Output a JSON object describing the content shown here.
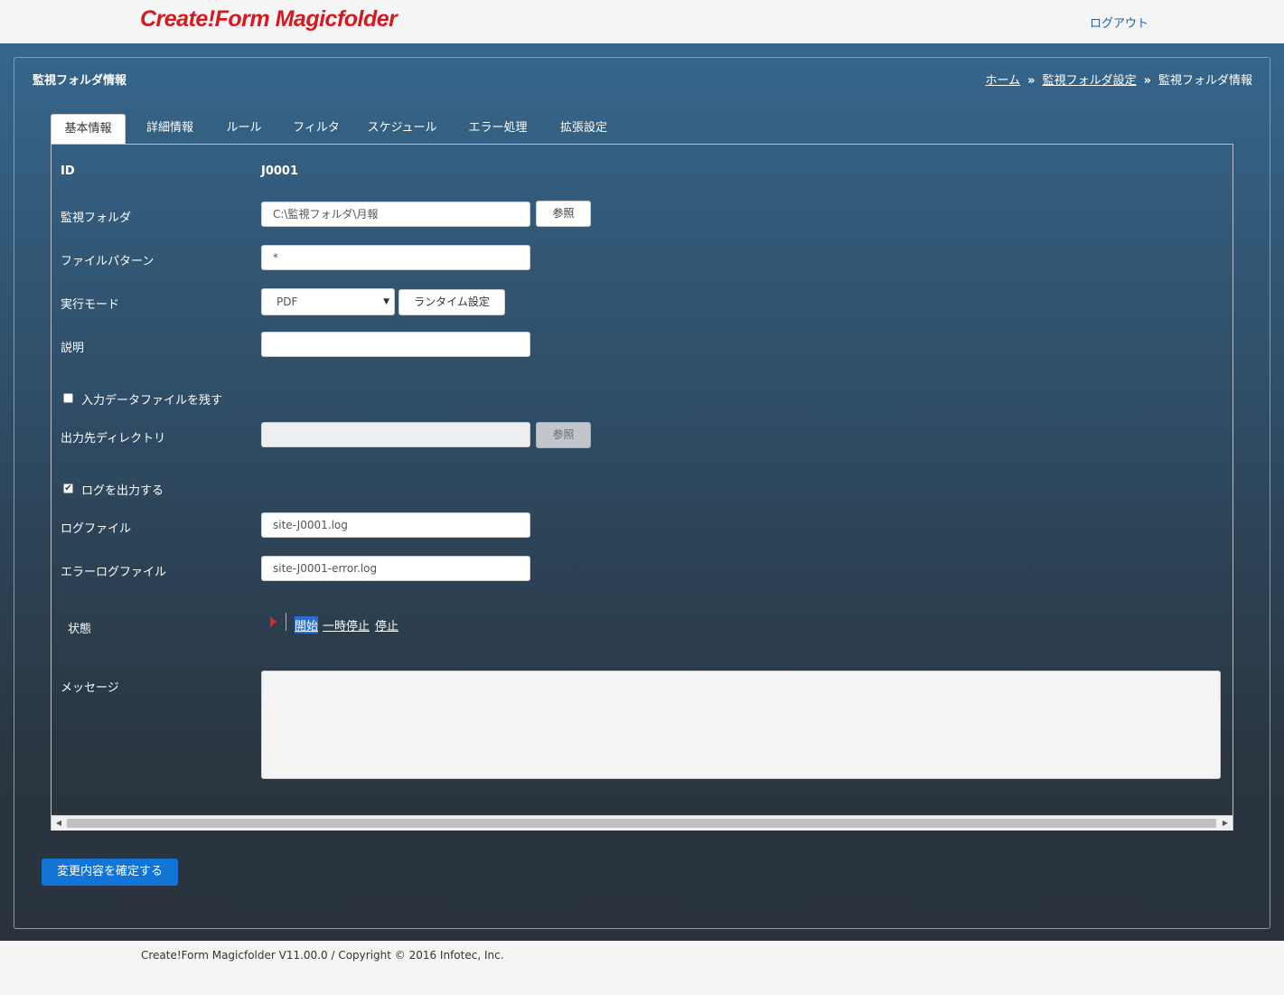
{
  "header": {
    "logo": "Create!Form Magicfolder",
    "logout": "ログアウト"
  },
  "panel": {
    "title": "監視フォルダ情報",
    "breadcrumb": {
      "home": "ホーム",
      "settings": "監視フォルダ設定",
      "current": "監視フォルダ情報",
      "separator": "»"
    }
  },
  "tabs": [
    {
      "label": "基本情報",
      "active": true
    },
    {
      "label": "詳細情報"
    },
    {
      "label": "ルール"
    },
    {
      "label": "フィルタ"
    },
    {
      "label": "スケジュール"
    },
    {
      "label": "エラー処理"
    },
    {
      "label": "拡張設定"
    }
  ],
  "form": {
    "id_label": "ID",
    "id_value": "J0001",
    "folder_label": "監視フォルダ",
    "folder_value": "C:\\監視フォルダ\\月報",
    "browse_label": "参照",
    "pattern_label": "ファイルパターン",
    "pattern_value": "*",
    "mode_label": "実行モード",
    "mode_value": "PDF",
    "runtime_button": "ランタイム設定",
    "description_label": "説明",
    "description_value": "",
    "keep_input_label": "入力データファイルを残す",
    "keep_input_checked": false,
    "output_dir_label": "出力先ディレクトリ",
    "output_dir_value": "",
    "output_browse_label": "参照",
    "log_output_label": "ログを出力する",
    "log_output_checked": true,
    "log_file_label": "ログファイル",
    "log_file_value": "site-J0001.log",
    "error_log_label": "エラーログファイル",
    "error_log_value": "site-J0001-error.log",
    "status_label": "状態",
    "status_start": "開始",
    "status_pause": "一時停止",
    "status_stop": "停止",
    "message_label": "メッセージ",
    "message_value": ""
  },
  "actions": {
    "confirm": "変更内容を確定する"
  },
  "footer": {
    "text": "Create!Form Magicfolder V11.00.0 / Copyright © 2016 Infotec, Inc."
  },
  "colors": {
    "logo": "#d51920",
    "primary_button": "#1275d6",
    "band_top": "#36668c",
    "band_bottom": "#2a333d"
  },
  "icons": {
    "status": "play-icon",
    "select": "chevron-down-icon"
  }
}
